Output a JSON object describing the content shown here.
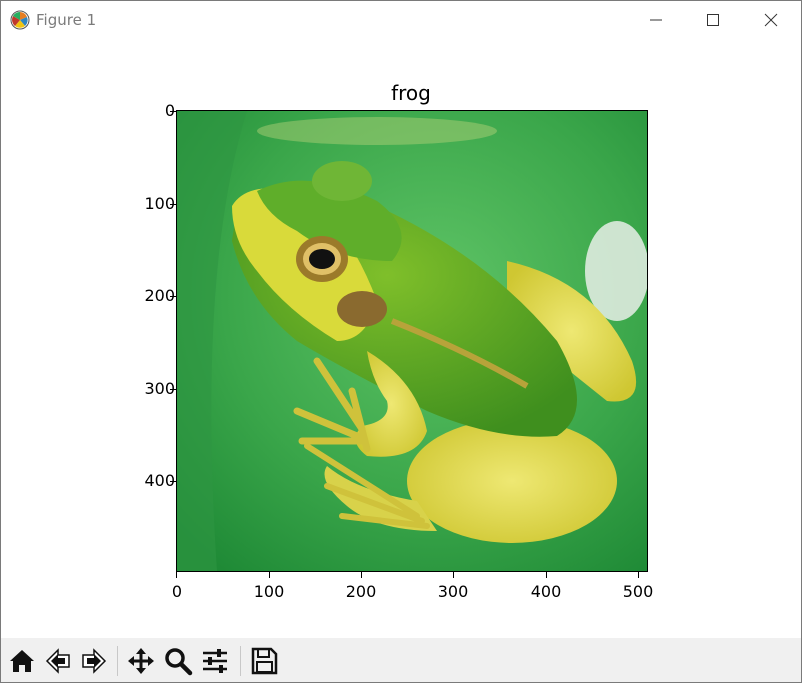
{
  "window": {
    "title": "Figure 1",
    "icons": [
      "matplotlib-logo-icon",
      "minimize-icon",
      "maximize-icon",
      "close-icon"
    ]
  },
  "chart_data": {
    "type": "image",
    "title": "frog",
    "xlabel": "",
    "ylabel": "",
    "x_ticks": [
      "0",
      "100",
      "200",
      "300",
      "400",
      "500"
    ],
    "y_ticks": [
      "0",
      "100",
      "200",
      "300",
      "400"
    ],
    "xlim": [
      0,
      511
    ],
    "ylim": [
      499,
      0
    ],
    "grid": false,
    "legend": "none"
  },
  "toolbar": {
    "items": [
      "home-icon",
      "back-icon",
      "forward-icon",
      "pan-icon",
      "zoom-icon",
      "configure-subplots-icon",
      "save-icon"
    ]
  },
  "colors": {
    "toolbar_bg": "#f0f0f0",
    "leaf_green": "#3aa64a",
    "frog_green": "#5fae2a",
    "frog_yellow": "#d9d63a"
  }
}
